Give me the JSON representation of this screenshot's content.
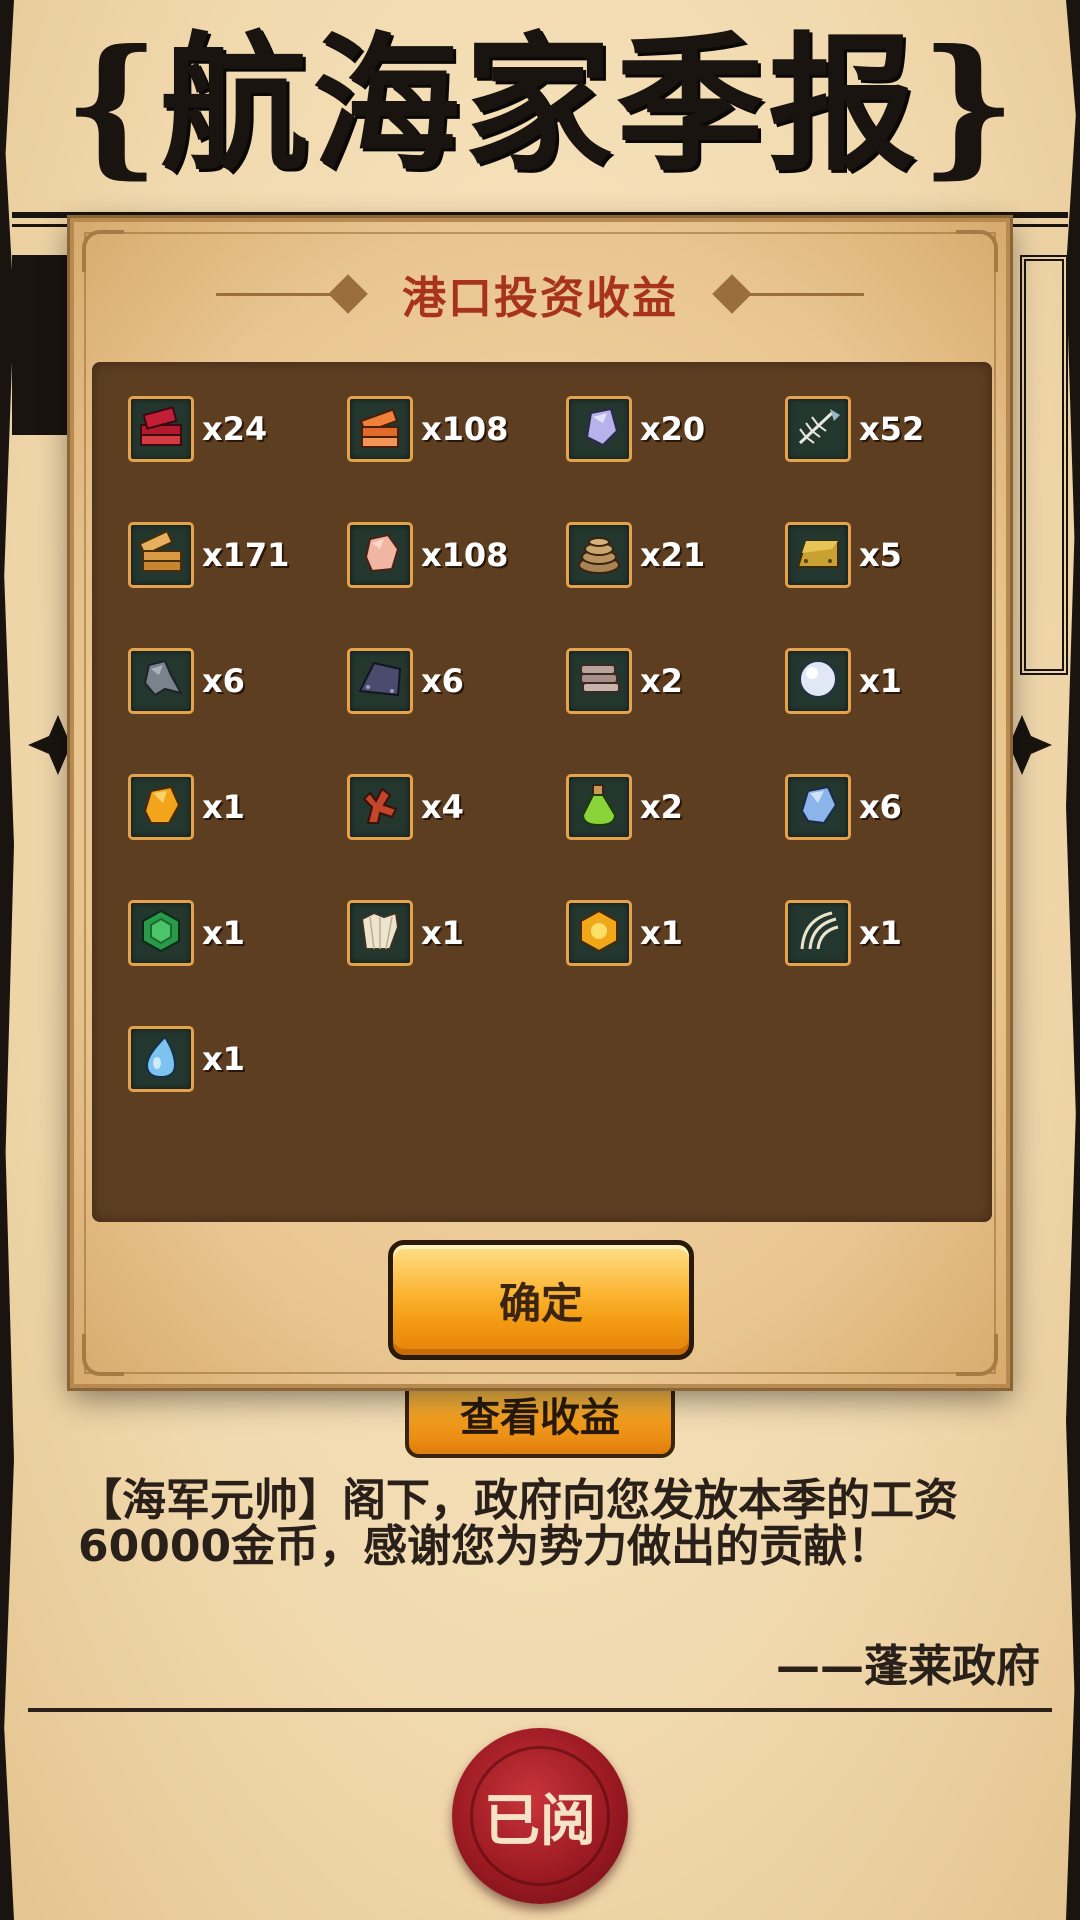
{
  "newspaper": {
    "masthead_title": "航海家季报",
    "masthead_bracket_left": "{",
    "masthead_bracket_right": "}",
    "view_income_label": "查看收益",
    "letter_text": "【海军元帅】阁下，政府向您发放本季的工资60000金币，感谢您为势力做出的贡献！",
    "signature": "——蓬莱政府",
    "seal_label": "已阅"
  },
  "modal": {
    "title": "港口投资收益",
    "confirm_label": "确定",
    "items": [
      {
        "icon": "red-wood-planks-icon",
        "count": "x24"
      },
      {
        "icon": "orange-wood-planks-icon",
        "count": "x108"
      },
      {
        "icon": "purple-crystal-icon",
        "count": "x20"
      },
      {
        "icon": "fish-bone-icon",
        "count": "x52"
      },
      {
        "icon": "wood-log-planks-icon",
        "count": "x171"
      },
      {
        "icon": "pink-stone-icon",
        "count": "x108"
      },
      {
        "icon": "rope-coil-icon",
        "count": "x21"
      },
      {
        "icon": "gold-ingot-icon",
        "count": "x5"
      },
      {
        "icon": "iron-ore-icon",
        "count": "x6"
      },
      {
        "icon": "iron-plate-icon",
        "count": "x6"
      },
      {
        "icon": "cloth-bolts-icon",
        "count": "x2"
      },
      {
        "icon": "pearl-icon",
        "count": "x1"
      },
      {
        "icon": "amber-gem-icon",
        "count": "x1"
      },
      {
        "icon": "red-coral-icon",
        "count": "x4"
      },
      {
        "icon": "green-potion-icon",
        "count": "x2"
      },
      {
        "icon": "blue-crystal-icon",
        "count": "x6"
      },
      {
        "icon": "emerald-hexagon-icon",
        "count": "x1"
      },
      {
        "icon": "shell-fan-icon",
        "count": "x1"
      },
      {
        "icon": "gold-hexagon-gem-icon",
        "count": "x1"
      },
      {
        "icon": "animal-rib-bones-icon",
        "count": "x1"
      },
      {
        "icon": "water-drop-icon",
        "count": "x1"
      }
    ]
  },
  "colors": {
    "modal_title": "#a8331c",
    "panel_bg": "#5e3e21",
    "icon_border": "#e6a24a",
    "button_orange": "#f39a12",
    "seal_red": "#9c1a22"
  }
}
